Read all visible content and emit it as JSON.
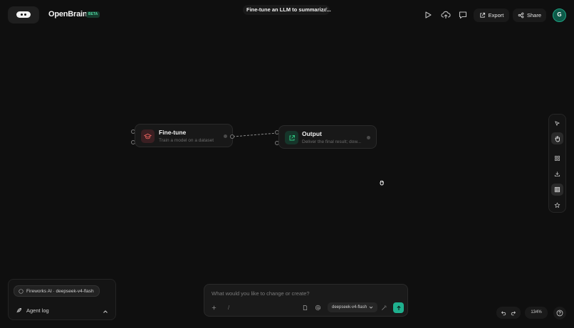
{
  "header": {
    "brand": "OpenBrain",
    "badge": "BETA",
    "project_title": "Fine-tune an LLM to summarize...",
    "export_label": "Export",
    "share_label": "Share",
    "avatar_initial": "G"
  },
  "nodes": [
    {
      "title": "Fine-tune",
      "subtitle": "Train a model on a dataset",
      "icon": "graduation-cap-icon"
    },
    {
      "title": "Output",
      "subtitle": "Deliver the final result; dow...",
      "icon": "external-link-icon"
    }
  ],
  "agent": {
    "model_chip": "Fireworks AI · deepseek-v4-flash",
    "log_label": "Agent log"
  },
  "prompt": {
    "placeholder": "What would you like to change or create?",
    "slash": "/",
    "model": "deepseek-v4-flash"
  },
  "zoom": "134%",
  "colors": {
    "background": "#0f0f0f",
    "accent": "#1fb08e",
    "finetune_icon": "#d9534f",
    "output_icon": "#2ec27e"
  }
}
